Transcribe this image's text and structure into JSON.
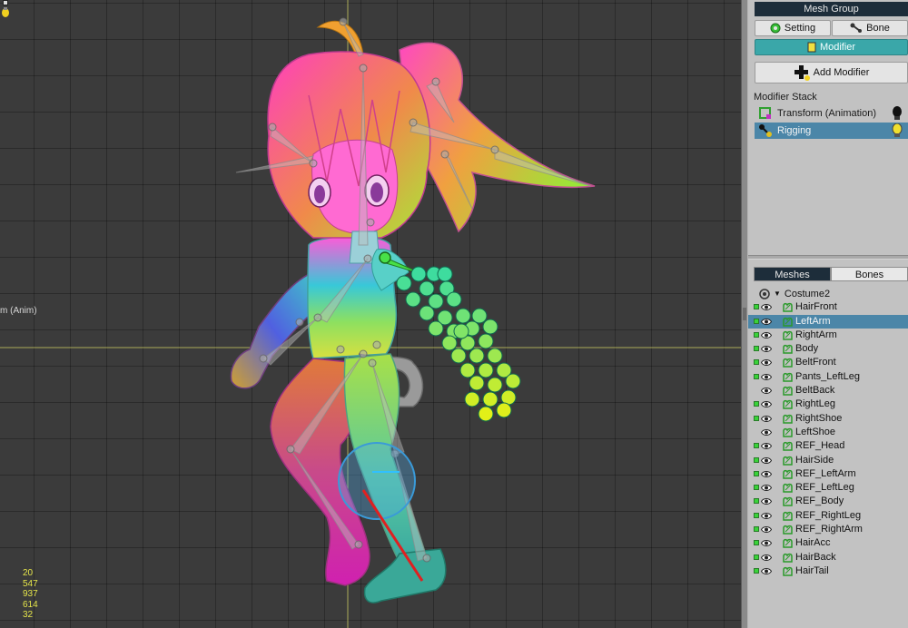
{
  "viewport": {
    "anim_label": "m (Anim)",
    "stats": [
      "20",
      "547",
      "937",
      "614",
      "32"
    ]
  },
  "panel": {
    "mesh_group_title": "Mesh Group",
    "setting_label": "Setting",
    "bone_label": "Bone",
    "modifier_label": "Modifier",
    "add_modifier_label": "Add Modifier",
    "modifier_stack_label": "Modifier Stack",
    "stack": [
      {
        "label": "Transform (Animation)",
        "selected": false
      },
      {
        "label": "Rigging",
        "selected": true
      }
    ],
    "tabs": {
      "meshes": "Meshes",
      "bones": "Bones"
    },
    "root_name": "Costume2",
    "meshes": [
      {
        "name": "HairFront",
        "visible_checked": true,
        "selected": false
      },
      {
        "name": "LeftArm",
        "visible_checked": true,
        "selected": true
      },
      {
        "name": "RightArm",
        "visible_checked": true,
        "selected": false
      },
      {
        "name": "Body",
        "visible_checked": true,
        "selected": false
      },
      {
        "name": "BeltFront",
        "visible_checked": true,
        "selected": false
      },
      {
        "name": "Pants_LeftLeg",
        "visible_checked": true,
        "selected": false
      },
      {
        "name": "BeltBack",
        "visible_checked": false,
        "selected": false
      },
      {
        "name": "RightLeg",
        "visible_checked": true,
        "selected": false
      },
      {
        "name": "RightShoe",
        "visible_checked": true,
        "selected": false
      },
      {
        "name": "LeftShoe",
        "visible_checked": false,
        "selected": false
      },
      {
        "name": "REF_Head",
        "visible_checked": true,
        "selected": false
      },
      {
        "name": "HairSide",
        "visible_checked": true,
        "selected": false
      },
      {
        "name": "REF_LeftArm",
        "visible_checked": true,
        "selected": false
      },
      {
        "name": "REF_LeftLeg",
        "visible_checked": true,
        "selected": false
      },
      {
        "name": "REF_Body",
        "visible_checked": true,
        "selected": false
      },
      {
        "name": "REF_RightLeg",
        "visible_checked": true,
        "selected": false
      },
      {
        "name": "REF_RightArm",
        "visible_checked": true,
        "selected": false
      },
      {
        "name": "HairAcc",
        "visible_checked": true,
        "selected": false
      },
      {
        "name": "HairBack",
        "visible_checked": true,
        "selected": false
      },
      {
        "name": "HairTail",
        "visible_checked": true,
        "selected": false
      }
    ]
  },
  "colors": {
    "accent_teal": "#3aa7a9",
    "selection_blue": "#4b86a8",
    "header_navy": "#1d2d3a",
    "stats_yellow": "#e6e64a"
  }
}
